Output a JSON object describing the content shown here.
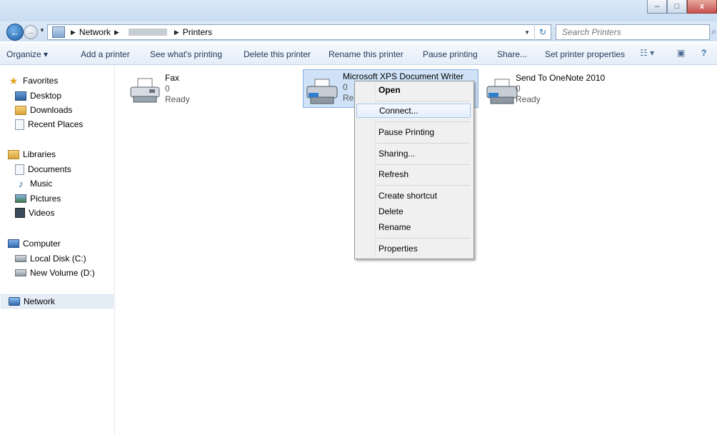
{
  "window": {
    "minimize_icon": "minimize-icon",
    "maximize_icon": "maximize-icon",
    "close_label": "x"
  },
  "nav": {
    "breadcrumbs": [
      "Network",
      "Printers"
    ],
    "search_placeholder": "Search Printers"
  },
  "toolbar": {
    "organize": "Organize ▾",
    "add_printer": "Add a printer",
    "see_printing": "See what's printing",
    "delete_printer": "Delete this printer",
    "rename_printer": "Rename this printer",
    "pause_printing": "Pause printing",
    "share": "Share...",
    "set_properties": "Set printer properties"
  },
  "sidebar": {
    "favorites": "Favorites",
    "desktop": "Desktop",
    "downloads": "Downloads",
    "recent_places": "Recent Places",
    "libraries": "Libraries",
    "documents": "Documents",
    "music": "Music",
    "pictures": "Pictures",
    "videos": "Videos",
    "computer": "Computer",
    "local_disk": "Local Disk (C:)",
    "new_volume": "New Volume (D:)",
    "network": "Network"
  },
  "printers": [
    {
      "name": "Fax",
      "jobs": "0",
      "status": "Ready"
    },
    {
      "name": "Microsoft XPS Document Writer",
      "jobs": "0",
      "status": "Re"
    },
    {
      "name": "Send To OneNote 2010",
      "jobs": "0",
      "status": "Ready"
    }
  ],
  "context_menu": {
    "open": "Open",
    "connect": "Connect...",
    "pause_printing": "Pause Printing",
    "sharing": "Sharing...",
    "refresh": "Refresh",
    "create_shortcut": "Create shortcut",
    "delete": "Delete",
    "rename": "Rename",
    "properties": "Properties"
  },
  "colors": {
    "accent": "#2f6aaf",
    "selection": "#cfe2f7",
    "menu_bg": "#f0f0f0"
  }
}
